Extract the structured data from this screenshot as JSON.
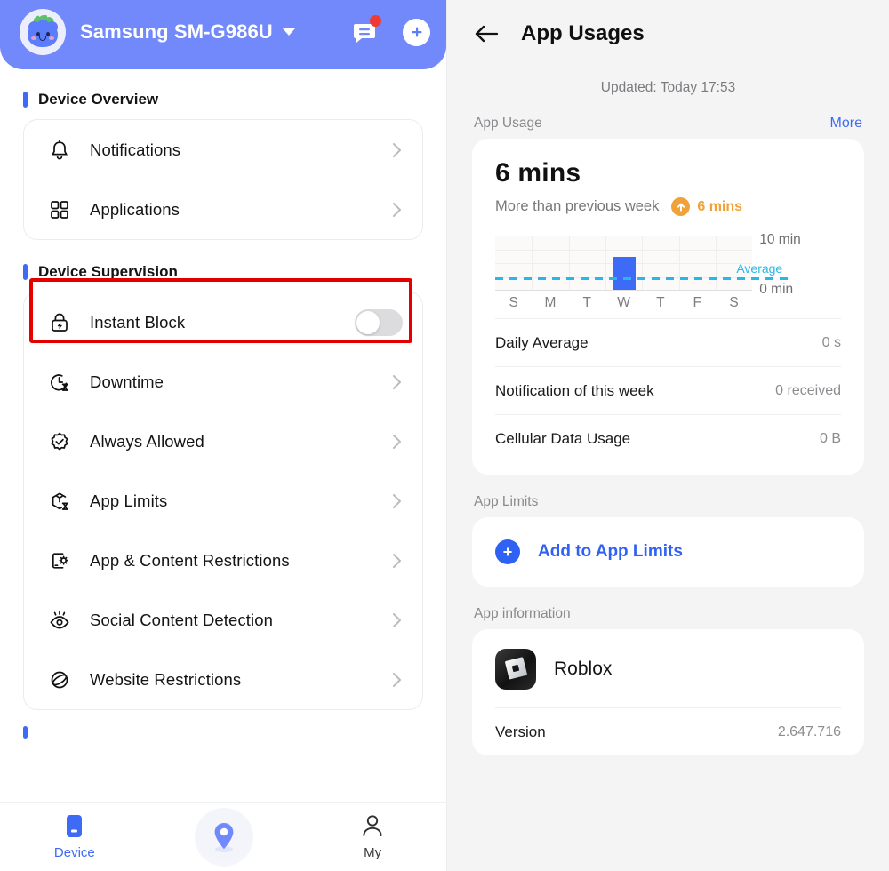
{
  "left": {
    "header": {
      "device_name": "Samsung SM-G986U",
      "avatar_icon": "blueberry-avatar",
      "dropdown_icon": "chevron-down-icon",
      "message_icon": "message-icon",
      "badge_icon": "notification-dot",
      "add_icon": "plus-icon"
    },
    "sections": [
      {
        "title": "Device Overview",
        "items": [
          {
            "label": "Notifications",
            "icon": "bell-icon",
            "accessory": "chevron"
          },
          {
            "label": "Applications",
            "icon": "grid-apps-icon",
            "accessory": "chevron",
            "highlighted": true
          }
        ]
      },
      {
        "title": "Device Supervision",
        "items": [
          {
            "label": "Instant Block",
            "icon": "lock-bolt-icon",
            "accessory": "toggle",
            "toggle_on": false
          },
          {
            "label": "Downtime",
            "icon": "clock-hourglass-icon",
            "accessory": "chevron"
          },
          {
            "label": "Always Allowed",
            "icon": "check-badge-icon",
            "accessory": "chevron"
          },
          {
            "label": "App Limits",
            "icon": "cube-hourglass-icon",
            "accessory": "chevron"
          },
          {
            "label": "App & Content Restrictions",
            "icon": "phone-gear-icon",
            "accessory": "chevron"
          },
          {
            "label": "Social Content Detection",
            "icon": "eye-icon",
            "accessory": "chevron"
          },
          {
            "label": "Website Restrictions",
            "icon": "globe-icon",
            "accessory": "chevron"
          }
        ]
      }
    ],
    "bottom_nav": [
      {
        "label": "Device",
        "icon": "phone-icon",
        "active": true
      },
      {
        "label": "",
        "icon": "location-pin-icon",
        "active": false
      },
      {
        "label": "My",
        "icon": "person-icon",
        "active": false
      }
    ]
  },
  "right": {
    "back_icon": "arrow-left-icon",
    "title": "App Usages",
    "updated": "Updated:  Today  17:53",
    "app_usage": {
      "group_title": "App Usage",
      "more_label": "More",
      "total": "6 mins",
      "trend_text": "More than previous week",
      "trend_icon": "arrow-up-icon",
      "trend_value": "6 mins",
      "stats": [
        {
          "key": "Daily Average",
          "value": "0 s"
        },
        {
          "key": "Notification of this week",
          "value": "0 received"
        },
        {
          "key": "Cellular Data Usage",
          "value": "0 B"
        }
      ]
    },
    "app_limits": {
      "group_title": "App Limits",
      "add_icon": "plus-circle-icon",
      "add_label": "Add to App Limits"
    },
    "app_information": {
      "group_title": "App information",
      "app_icon": "roblox-icon",
      "app_name": "Roblox",
      "rows": [
        {
          "key": "Version",
          "value": "2.647.716"
        }
      ]
    }
  },
  "chart_data": {
    "type": "bar",
    "title": "App Usage",
    "categories": [
      "S",
      "M",
      "T",
      "W",
      "T",
      "F",
      "S"
    ],
    "values": [
      0,
      0,
      0,
      6,
      0,
      0,
      0
    ],
    "unit": "min",
    "ylim": [
      0,
      10
    ],
    "ytick_labels": [
      "10 min",
      "0 min"
    ],
    "xlabel": "",
    "ylabel": "",
    "grid": true,
    "bar_color": "#3d6bf5",
    "average": {
      "label": "Average",
      "value": 0.86,
      "color": "#29b6e8",
      "style": "dashed"
    },
    "legend": "none"
  },
  "colors": {
    "header_blue": "#7189fa",
    "accent_blue": "#3d6bf5",
    "link_blue": "#2f62f4",
    "orange": "#f0a23a",
    "cyan": "#29b6e8",
    "red_badge": "#ef3b33",
    "highlight_box": "#e50000",
    "page_bg": "#f4f4f4"
  }
}
